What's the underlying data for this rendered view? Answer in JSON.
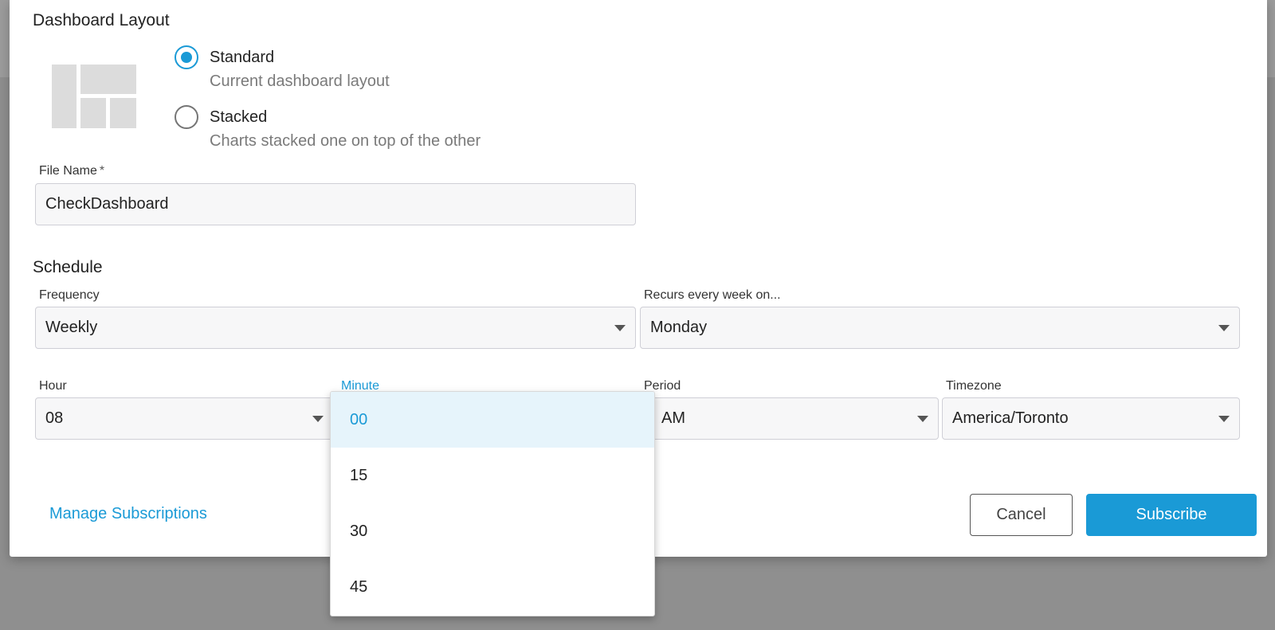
{
  "dashboard_layout": {
    "title": "Dashboard Layout",
    "options": [
      {
        "label": "Standard",
        "description": "Current dashboard layout",
        "selected": true
      },
      {
        "label": "Stacked",
        "description": "Charts stacked one on top of the other",
        "selected": false
      }
    ]
  },
  "file_name": {
    "label": "File Name",
    "required_mark": "*",
    "value": "CheckDashboard"
  },
  "schedule": {
    "title": "Schedule",
    "frequency": {
      "label": "Frequency",
      "value": "Weekly"
    },
    "recurs": {
      "label": "Recurs every week on...",
      "value": "Monday"
    },
    "hour": {
      "label": "Hour",
      "value": "08"
    },
    "minute": {
      "label": "Minute",
      "options": [
        "00",
        "15",
        "30",
        "45"
      ],
      "selected": "00"
    },
    "period": {
      "label": "Period",
      "value": "AM"
    },
    "timezone": {
      "label": "Timezone",
      "value": "America/Toronto"
    }
  },
  "footer": {
    "manage_link": "Manage Subscriptions",
    "cancel_label": "Cancel",
    "subscribe_label": "Subscribe"
  },
  "colors": {
    "accent": "#1a9ad6",
    "selected_item_bg": "#e6f4fb",
    "backdrop": "#8f8f8f"
  },
  "icons": {
    "layout_thumbnail": "layout-grid-icon",
    "select_arrow": "caret-down-icon"
  }
}
